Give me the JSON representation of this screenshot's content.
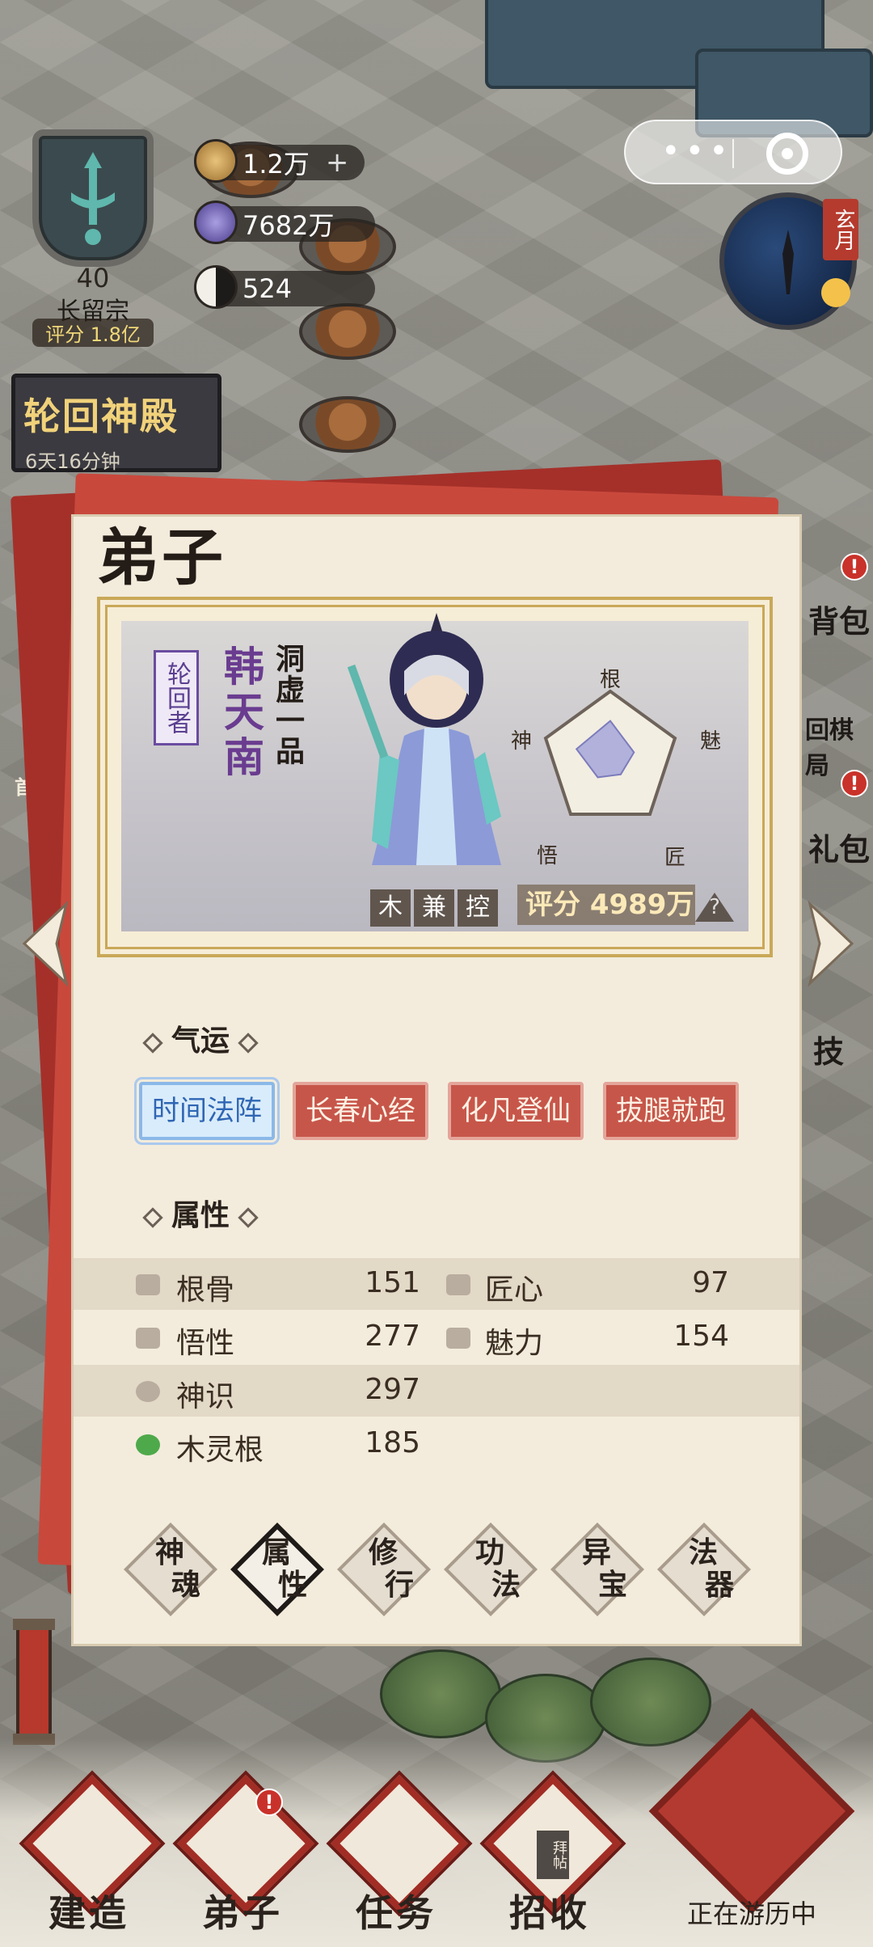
{
  "sect": {
    "level": "40",
    "name": "长留宗",
    "score": "评分 1.8亿"
  },
  "resources": [
    {
      "value": "1.2万",
      "plus": "+",
      "icon": "spirit-stone-icon",
      "color": "#c9a25a"
    },
    {
      "value": "7682万",
      "plus": "",
      "icon": "crystal-icon",
      "color": "#6a5aa8"
    },
    {
      "value": "524",
      "plus": "",
      "icon": "yin-yang-icon",
      "color": "#e8e4dc"
    }
  ],
  "palace": {
    "title": "轮回神殿",
    "timer": "6天16分钟"
  },
  "capsule": {
    "more": "•••"
  },
  "moon_tag": "玄月",
  "side": {
    "left_hint": "首",
    "right_items": [
      "背包",
      "回棋局",
      "礼包",
      "技"
    ]
  },
  "dialog": {
    "title": "弟子",
    "character": {
      "tag": "轮回者",
      "name": "韩天南",
      "rank": "洞虚一品",
      "traits": [
        "木",
        "兼",
        "控"
      ],
      "score": "评分 4989万",
      "help": "?"
    },
    "radar_labels": [
      "根",
      "魅",
      "匠",
      "悟",
      "神"
    ],
    "radar_values": [
      0.55,
      0.35,
      0.25,
      0.3,
      0.5
    ],
    "fortune_heading": "气运",
    "fortunes": [
      {
        "label": "时间法阵",
        "style": "blue"
      },
      {
        "label": "长春心经",
        "style": "red"
      },
      {
        "label": "化凡登仙",
        "style": "red"
      },
      {
        "label": "拔腿就跑",
        "style": "red"
      }
    ],
    "attr_heading": "属性",
    "attributes": [
      {
        "left_label": "根骨",
        "left_value": "151",
        "right_label": "匠心",
        "right_value": "97"
      },
      {
        "left_label": "悟性",
        "left_value": "277",
        "right_label": "魅力",
        "right_value": "154"
      },
      {
        "left_label": "神识",
        "left_value": "297",
        "right_label": "",
        "right_value": ""
      },
      {
        "left_label": "木灵根",
        "left_value": "185",
        "right_label": "",
        "right_value": ""
      }
    ],
    "tabs": [
      {
        "l1": "神",
        "l2": "魂"
      },
      {
        "l1": "属",
        "l2": "性"
      },
      {
        "l1": "修",
        "l2": "行"
      },
      {
        "l1": "功",
        "l2": "法"
      },
      {
        "l1": "异",
        "l2": "宝"
      },
      {
        "l1": "法",
        "l2": "器"
      }
    ],
    "active_tab": 1
  },
  "nav": {
    "items": [
      "建造",
      "弟子",
      "任务",
      "招收"
    ],
    "alert": "!",
    "travel": "正在游历中",
    "invite_card": "拜帖"
  }
}
